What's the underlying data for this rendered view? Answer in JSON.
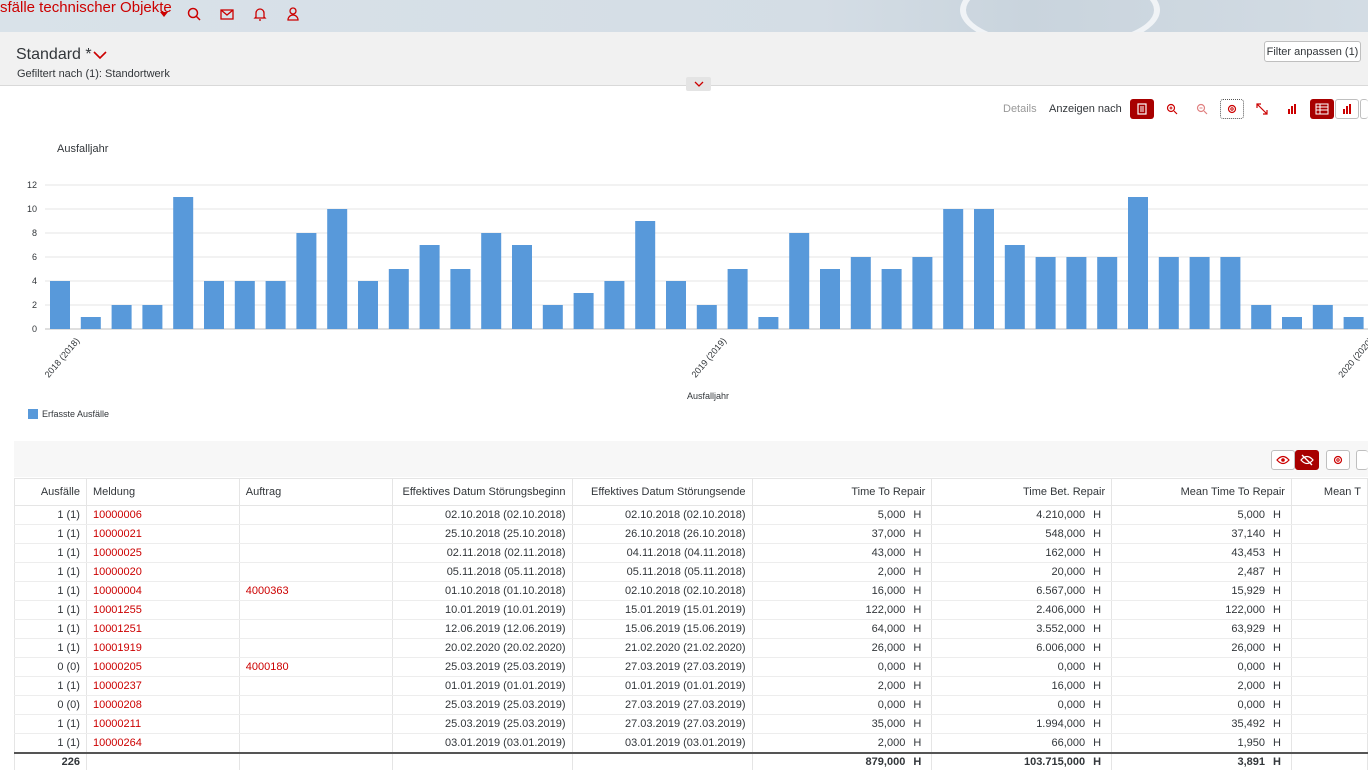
{
  "shell": {
    "app_title": "sfälle technischer Objekte",
    "icons": [
      "chevron-down-icon",
      "search-icon",
      "mail-icon",
      "bell-icon",
      "user-icon"
    ]
  },
  "header": {
    "variant": "Standard *",
    "filtered": "Gefiltert nach (1): Standortwerk",
    "filter_button": "Filter anpassen (1)"
  },
  "chart_toolbar": {
    "details": "Details",
    "show_by": "Anzeigen nach"
  },
  "colors": {
    "accent": "#a80000",
    "link": "#cc0000",
    "bar": "#5899da"
  },
  "chart_data": {
    "type": "bar",
    "title": "Ausfalljahr",
    "xlabel": "Ausfalljahr",
    "ylabel": "",
    "ylim": [
      0,
      12
    ],
    "yticks": [
      0,
      2,
      4,
      6,
      8,
      10,
      12
    ],
    "grid": true,
    "legend_position": "bottom-left",
    "tick_labels": [
      {
        "index": 0,
        "label": "2018 (2018)"
      },
      {
        "index": 21,
        "label": "2019 (2019)"
      },
      {
        "index": 42,
        "label": "2020 (2020)"
      }
    ],
    "series": [
      {
        "name": "Erfasste Ausfälle",
        "values": [
          4,
          1,
          2,
          2,
          11,
          4,
          4,
          4,
          8,
          10,
          4,
          5,
          7,
          5,
          8,
          7,
          2,
          3,
          4,
          9,
          4,
          2,
          5,
          1,
          8,
          5,
          6,
          5,
          6,
          10,
          10,
          7,
          6,
          6,
          6,
          11,
          6,
          6,
          6,
          2,
          1,
          2,
          1
        ]
      }
    ]
  },
  "table": {
    "columns": [
      "Ausfälle",
      "Meldung",
      "Auftrag",
      "Effektives Datum Störungsbeginn",
      "Effektives Datum Störungsende",
      "Time To Repair",
      "Time Bet. Repair",
      "Mean Time To Repair",
      "Mean T"
    ],
    "rows": [
      {
        "ausfaelle": "1 (1)",
        "meldung": "10000006",
        "auftrag": "",
        "beginn": "02.10.2018 (02.10.2018)",
        "ende": "02.10.2018 (02.10.2018)",
        "ttr": "5,000",
        "tbr": "4.210,000",
        "mttr": "5,000"
      },
      {
        "ausfaelle": "1 (1)",
        "meldung": "10000021",
        "auftrag": "",
        "beginn": "25.10.2018 (25.10.2018)",
        "ende": "26.10.2018 (26.10.2018)",
        "ttr": "37,000",
        "tbr": "548,000",
        "mttr": "37,140"
      },
      {
        "ausfaelle": "1 (1)",
        "meldung": "10000025",
        "auftrag": "",
        "beginn": "02.11.2018 (02.11.2018)",
        "ende": "04.11.2018 (04.11.2018)",
        "ttr": "43,000",
        "tbr": "162,000",
        "mttr": "43,453"
      },
      {
        "ausfaelle": "1 (1)",
        "meldung": "10000020",
        "auftrag": "",
        "beginn": "05.11.2018 (05.11.2018)",
        "ende": "05.11.2018 (05.11.2018)",
        "ttr": "2,000",
        "tbr": "20,000",
        "mttr": "2,487"
      },
      {
        "ausfaelle": "1 (1)",
        "meldung": "10000004",
        "auftrag": "4000363",
        "beginn": "01.10.2018 (01.10.2018)",
        "ende": "02.10.2018 (02.10.2018)",
        "ttr": "16,000",
        "tbr": "6.567,000",
        "mttr": "15,929"
      },
      {
        "ausfaelle": "1 (1)",
        "meldung": "10001255",
        "auftrag": "",
        "beginn": "10.01.2019 (10.01.2019)",
        "ende": "15.01.2019 (15.01.2019)",
        "ttr": "122,000",
        "tbr": "2.406,000",
        "mttr": "122,000"
      },
      {
        "ausfaelle": "1 (1)",
        "meldung": "10001251",
        "auftrag": "",
        "beginn": "12.06.2019 (12.06.2019)",
        "ende": "15.06.2019 (15.06.2019)",
        "ttr": "64,000",
        "tbr": "3.552,000",
        "mttr": "63,929"
      },
      {
        "ausfaelle": "1 (1)",
        "meldung": "10001919",
        "auftrag": "",
        "beginn": "20.02.2020 (20.02.2020)",
        "ende": "21.02.2020 (21.02.2020)",
        "ttr": "26,000",
        "tbr": "6.006,000",
        "mttr": "26,000"
      },
      {
        "ausfaelle": "0 (0)",
        "meldung": "10000205",
        "auftrag": "4000180",
        "beginn": "25.03.2019 (25.03.2019)",
        "ende": "27.03.2019 (27.03.2019)",
        "ttr": "0,000",
        "tbr": "0,000",
        "mttr": "0,000"
      },
      {
        "ausfaelle": "1 (1)",
        "meldung": "10000237",
        "auftrag": "",
        "beginn": "01.01.2019 (01.01.2019)",
        "ende": "01.01.2019 (01.01.2019)",
        "ttr": "2,000",
        "tbr": "16,000",
        "mttr": "2,000"
      },
      {
        "ausfaelle": "0 (0)",
        "meldung": "10000208",
        "auftrag": "",
        "beginn": "25.03.2019 (25.03.2019)",
        "ende": "27.03.2019 (27.03.2019)",
        "ttr": "0,000",
        "tbr": "0,000",
        "mttr": "0,000"
      },
      {
        "ausfaelle": "1 (1)",
        "meldung": "10000211",
        "auftrag": "",
        "beginn": "25.03.2019 (25.03.2019)",
        "ende": "27.03.2019 (27.03.2019)",
        "ttr": "35,000",
        "tbr": "1.994,000",
        "mttr": "35,492"
      },
      {
        "ausfaelle": "1 (1)",
        "meldung": "10000264",
        "auftrag": "",
        "beginn": "03.01.2019 (03.01.2019)",
        "ende": "03.01.2019 (03.01.2019)",
        "ttr": "2,000",
        "tbr": "66,000",
        "mttr": "1,950"
      }
    ],
    "unit": "H",
    "total": {
      "ausfaelle": "226",
      "ttr": "879,000",
      "tbr": "103.715,000",
      "mttr": "3,891"
    }
  }
}
